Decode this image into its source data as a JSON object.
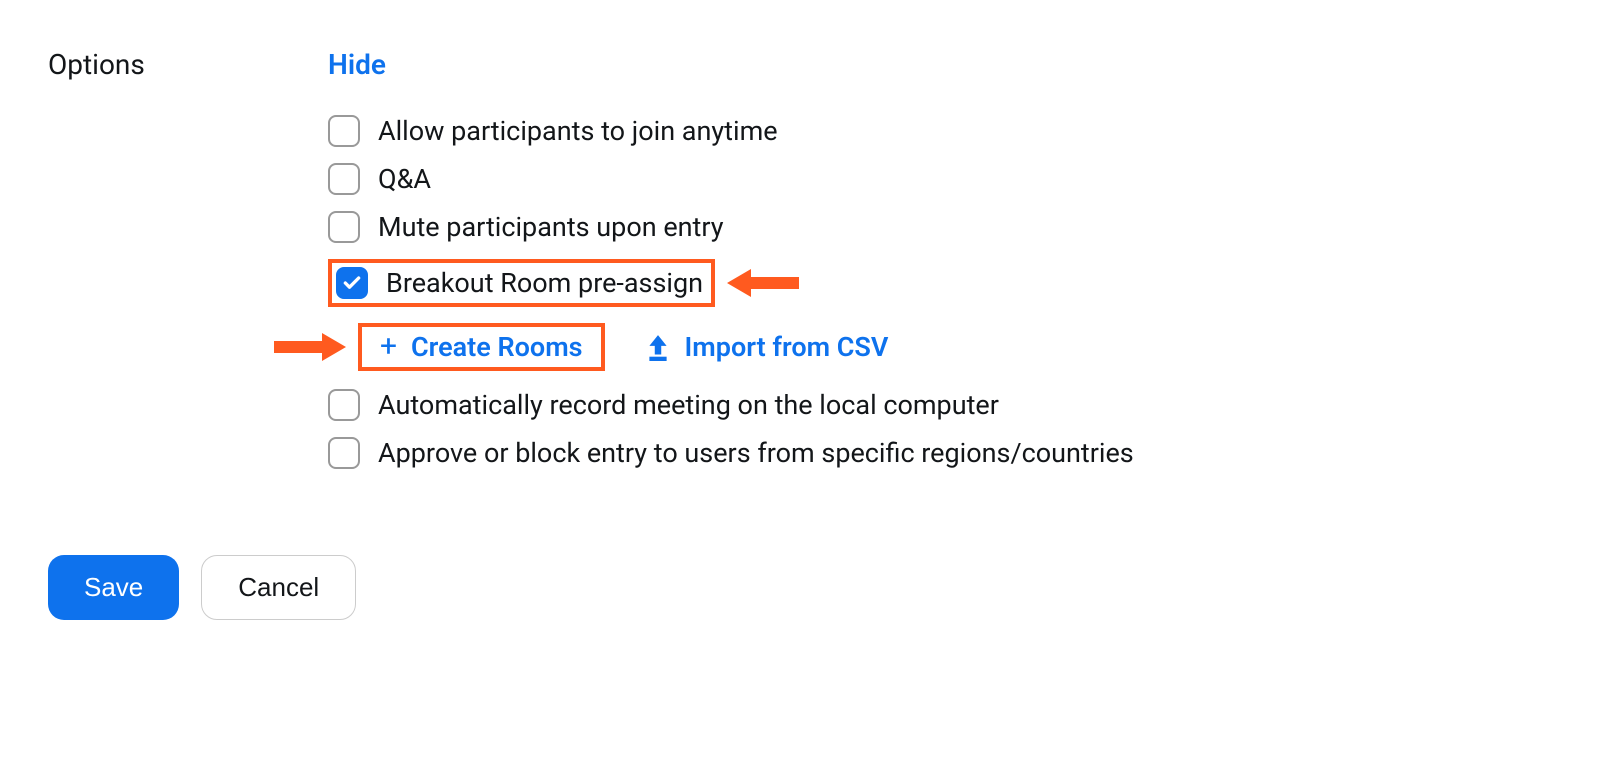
{
  "section": {
    "label": "Options",
    "hide_link": "Hide"
  },
  "options": {
    "allow_join_anytime": {
      "label": "Allow participants to join anytime",
      "checked": false
    },
    "qa": {
      "label": "Q&A",
      "checked": false
    },
    "mute_on_entry": {
      "label": "Mute participants upon entry",
      "checked": false
    },
    "breakout_preassign": {
      "label": "Breakout Room pre-assign",
      "checked": true
    },
    "auto_record_local": {
      "label": "Automatically record meeting on the local computer",
      "checked": false
    },
    "approve_block_regions": {
      "label": "Approve or block entry to users from specific regions/countries",
      "checked": false
    }
  },
  "breakout_actions": {
    "create_rooms": "Create Rooms",
    "import_csv": "Import from CSV"
  },
  "footer": {
    "save": "Save",
    "cancel": "Cancel"
  },
  "annotations": {
    "highlight_color": "#ff5a1f",
    "accent_color": "#0e72ed"
  }
}
